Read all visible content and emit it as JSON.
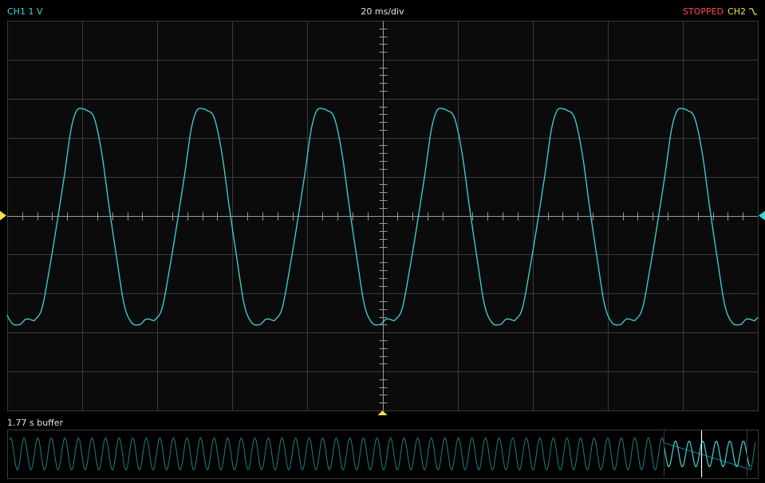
{
  "header": {
    "ch1_label": "CH1 1 V",
    "timebase": "20 ms/div",
    "status": "STOPPED",
    "ch2_label": "CH2",
    "trigger_icon": "trigger-falling-edge-icon"
  },
  "buffer": {
    "label": "1.77 s buffer"
  },
  "colors": {
    "background": "#000000",
    "grid": "#3a3a3a",
    "axis": "#9a9a9a",
    "ch1": "#3ad6dc",
    "ch2": "#f2e14a",
    "status": "#ff4a4a",
    "text": "#e6e6e6",
    "window": "#ffffff"
  },
  "screen": {
    "divisions_x": 10,
    "divisions_y": 10,
    "volts_per_div": 1,
    "ms_per_div": 20
  },
  "chart_data": {
    "type": "line",
    "title": "",
    "xlabel": "",
    "ylabel": "",
    "xlim_ms": [
      -100,
      100
    ],
    "ylim_v": [
      -5,
      5
    ],
    "grid": true,
    "series": [
      {
        "name": "CH1",
        "frequency_hz": 31.25,
        "cycle_start_ms": [
          -92.8,
          -60.8,
          -28.8,
          3.2,
          35.2,
          67.2
        ],
        "cycle_shape_phase": [
          0,
          0.0625,
          0.125,
          0.25,
          0.3125,
          0.375,
          0.4375,
          0.5,
          0.5625,
          0.625,
          0.6875,
          0.75,
          0.8125,
          0.875,
          0.9375,
          1.0
        ],
        "cycle_shape_v": [
          -2.7,
          -2.4,
          -1.4,
          1.0,
          2.3,
          2.75,
          2.7,
          2.5,
          1.6,
          0.2,
          -1.1,
          -2.3,
          -2.75,
          -2.8,
          -2.65,
          -2.7
        ],
        "visible_samples_v": [
          -2.8,
          2.75,
          -2.75,
          2.7,
          -2.75,
          2.65,
          -2.65,
          2.6,
          -2.7,
          2.6,
          -2.75,
          2.65,
          -2.6
        ]
      }
    ],
    "buffer_overview": {
      "duration_s": 1.77,
      "window_fraction": [
        0.875,
        0.99
      ],
      "window_marker_fraction": [
        0.875,
        0.925,
        0.985
      ]
    },
    "markers": {
      "ch1_offset_v": 0,
      "ch2_offset_v": 0,
      "trigger_time_ms": 0
    }
  }
}
